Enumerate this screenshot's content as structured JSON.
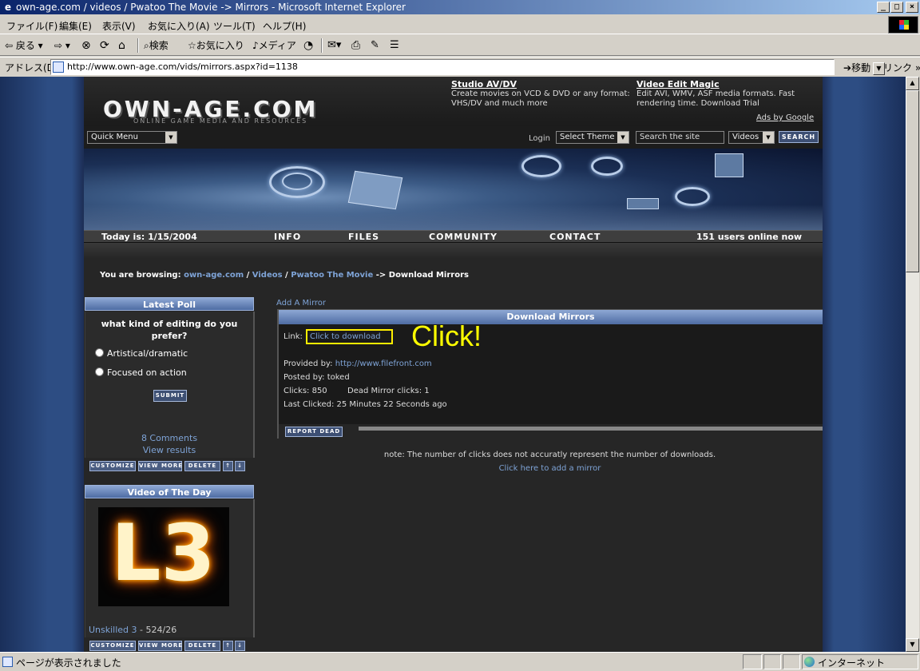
{
  "window": {
    "title": "own-age.com / videos / Pwatoo The Movie -> Mirrors - Microsoft Internet Explorer",
    "buttons": [
      "_",
      "□",
      "×"
    ]
  },
  "menubar": [
    "ファイル(F)",
    "編集(E)",
    "表示(V)",
    "お気に入り(A)",
    "ツール(T)",
    "ヘルプ(H)"
  ],
  "toolbar": {
    "back": "⇦ 戻る ▾",
    "forward": "⇨ ▾",
    "stop": "⊗",
    "refresh": "⟳",
    "home": "⌂",
    "search": "検索",
    "favorites": "お気に入り",
    "media": "メディア",
    "history": "◔",
    "mail": "✉▾",
    "print": "⎙",
    "edit": "✎",
    "discuss": "☰"
  },
  "addressbar": {
    "label": "アドレス(D)",
    "url": "http://www.own-age.com/vids/mirrors.aspx?id=1138",
    "go": "移動",
    "links": "リンク »"
  },
  "site": {
    "logo": "OWN-AGE.COM",
    "tagline": "ONLINE GAME MEDIA AND RESOURCES",
    "ads": [
      {
        "title": "Studio AV/DV",
        "text": "Create movies on VCD & DVD or any format: VHS/DV and much more"
      },
      {
        "title": "Video Edit Magic",
        "text": "Edit AVI, WMV, ASF media formats. Fast rendering time. Download Trial"
      }
    ],
    "ads_by": "Ads by Google",
    "quick_menu": "Quick Menu",
    "login": "Login",
    "select_theme": "Select Theme",
    "search_placeholder": "Search the site",
    "search_scope": "Videos",
    "search_button": "SEARCH",
    "today": "Today is: 1/15/2004",
    "nav": [
      "INFO",
      "FILES",
      "COMMUNITY",
      "CONTACT"
    ],
    "online": "151 users online now"
  },
  "breadcrumb": {
    "prefix": "You are browsing:",
    "home": "own-age.com",
    "sep": "/",
    "videos": "Videos",
    "movie": "Pwatoo The Movie",
    "arrow": "->",
    "current": "Download Mirrors"
  },
  "poll": {
    "title": "Latest Poll",
    "question": "what kind of editing do you prefer?",
    "options": [
      "Artistical/dramatic",
      "Focused on action"
    ],
    "submit": "SUBMIT",
    "comments": "8 Comments",
    "results": "View results",
    "controls": [
      "CUSTOMIZE",
      "VIEW MORE",
      "DELETE",
      "↑",
      "↓"
    ]
  },
  "vod": {
    "title": "Video of The Day",
    "thumb_glyph": "L3",
    "caption_link": "Unskilled 3",
    "caption_rest": " - 524/26",
    "controls": [
      "CUSTOMIZE",
      "VIEW MORE",
      "DELETE",
      "↑",
      "↓"
    ]
  },
  "mirrors": {
    "add_mirror": "Add A Mirror",
    "title": "Download Mirrors",
    "link_label": "Link:",
    "link_text": "Click to download",
    "annotation": "Click!",
    "provided_label": "Provided by:",
    "provided_url": "http://www.filefront.com",
    "posted_by": "Posted by: toked",
    "clicks": "Clicks: 850",
    "dead_clicks": "Dead Mirror clicks: 1",
    "last_clicked": "Last Clicked: 25 Minutes 22 Seconds ago",
    "report_dead": "REPORT DEAD",
    "note": "note: The number of clicks does not accuratly represent the number of downloads.",
    "add_here": "Click here to add a mirror"
  },
  "statusbar": {
    "text": "ページが表示されました",
    "zone": "インターネット"
  }
}
